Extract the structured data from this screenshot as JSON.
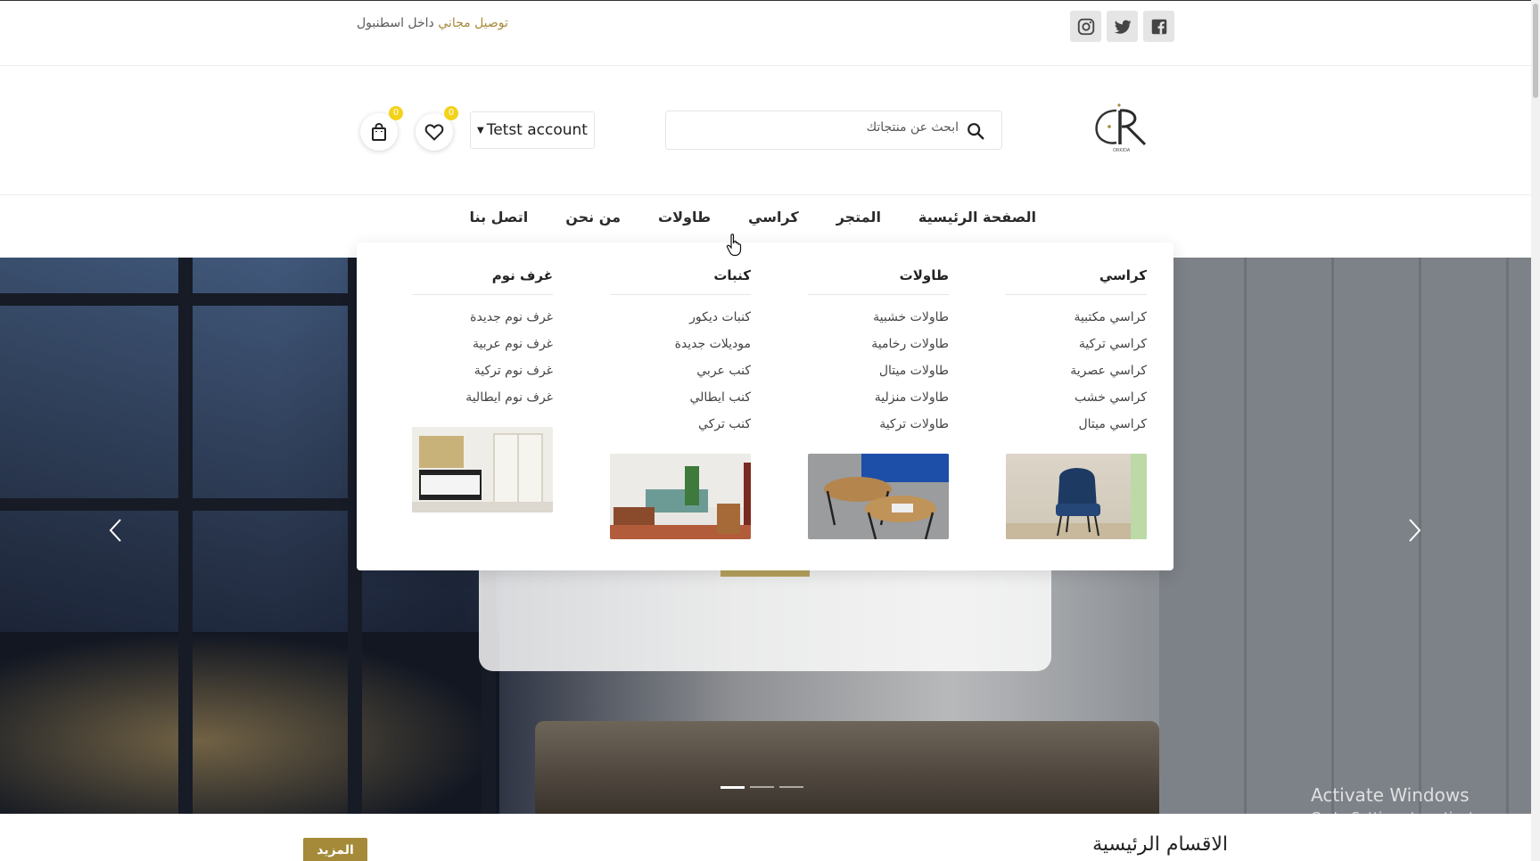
{
  "topbar": {
    "delivery_accent": "توصيل مجاني",
    "delivery_rest": " داخل اسطنبول",
    "socials": [
      {
        "icon": "instagram-icon"
      },
      {
        "icon": "twitter-icon"
      },
      {
        "icon": "facebook-icon"
      }
    ]
  },
  "header": {
    "logo_text": "ORKIDA",
    "search_placeholder": "ابحث عن منتجاتك",
    "account_label": "Tetst account",
    "wishlist_count": "0",
    "cart_count": "0"
  },
  "nav": {
    "items": [
      "الصفحة الرئيسية",
      "المتجر",
      "كراسي",
      "طاولات",
      "من نحن",
      "اتصل بنا"
    ]
  },
  "mega_menu": {
    "columns": [
      {
        "title": "كراسي",
        "items": [
          "كراسي مكتبية",
          "كراسي تركية",
          "كراسي عصرية",
          "كراسي خشب",
          "كراسي ميتال"
        ]
      },
      {
        "title": "طاولات",
        "items": [
          "طاولات خشبية",
          "طاولات رخامية",
          "طاولات ميتال",
          "طاولات منزلية",
          "طاولات تركية"
        ]
      },
      {
        "title": "كنبات",
        "items": [
          "كنبات ديكور",
          "موديلات جديدة",
          "كنب عربي",
          "كنب ايطالي",
          "كنب تركي"
        ]
      },
      {
        "title": "غرف نوم",
        "items": [
          "غرف نوم جديدة",
          "غرف نوم عربية",
          "غرف نوم تركية",
          "غرف نوم ايطالية"
        ]
      }
    ]
  },
  "bottom": {
    "section_title": "الاقسام الرئيسية",
    "more_label": "المزيد"
  },
  "watermark": {
    "line1": "Activate Windows",
    "line2": "Go to Settings to activate Windows."
  },
  "colors": {
    "accent": "#a58a3a",
    "badge": "#f3d21a"
  }
}
